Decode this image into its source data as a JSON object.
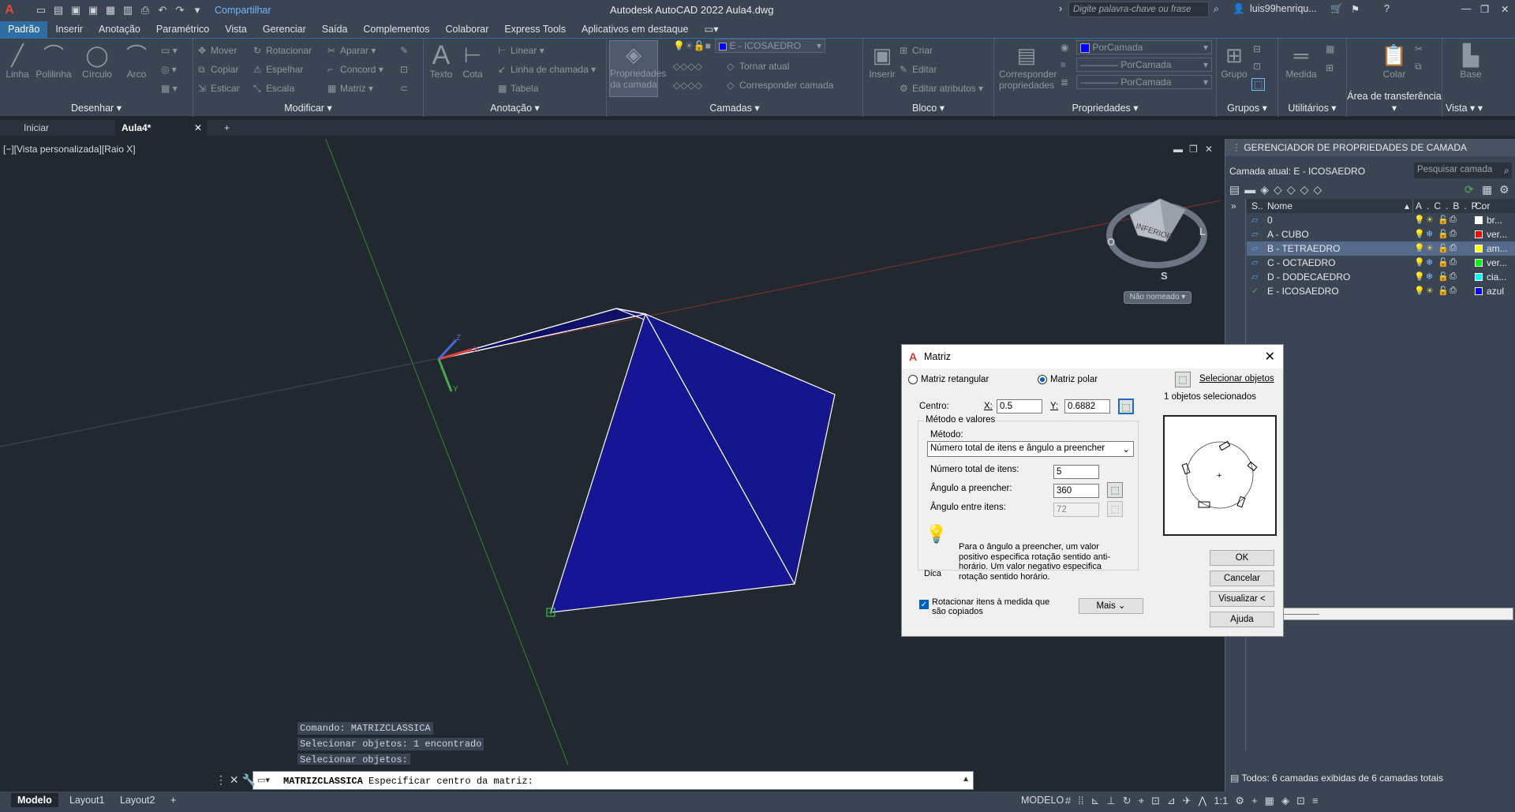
{
  "titlebar": {
    "app_title": "Autodesk AutoCAD 2022    Aula4.dwg",
    "share": "Compartilhar",
    "search_placeholder": "Digite palavra-chave ou frase",
    "user": "luis99henriqu..."
  },
  "ribbon_tabs": [
    "Padrão",
    "Inserir",
    "Anotação",
    "Paramétrico",
    "Vista",
    "Gerenciar",
    "Saída",
    "Complementos",
    "Colaborar",
    "Express Tools",
    "Aplicativos em destaque"
  ],
  "ribbon": {
    "desenhar": {
      "title": "Desenhar",
      "linha": "Linha",
      "polilinha": "Polilinha",
      "circulo": "Círculo",
      "arco": "Arco"
    },
    "modificar": {
      "title": "Modificar",
      "mover": "Mover",
      "rotacionar": "Rotacionar",
      "aparar": "Aparar",
      "copiar": "Copiar",
      "espelhar": "Espelhar",
      "concord": "Concord",
      "esticar": "Esticar",
      "escala": "Escala",
      "matriz": "Matriz"
    },
    "anotacao": {
      "title": "Anotação",
      "texto": "Texto",
      "cota": "Cota",
      "linear": "Linear",
      "linha_chamada": "Linha de chamada",
      "tabela": "Tabela"
    },
    "camadas": {
      "title": "Camadas",
      "prop_camada": "Propriedades da camada",
      "layer_dd": "E - ICOSAEDRO",
      "tornar_atual": "Tornar atual",
      "corresponder_camada": "Corresponder camada"
    },
    "bloco": {
      "title": "Bloco",
      "inserir": "Inserir",
      "criar": "Criar",
      "editar": "Editar",
      "editar_atributos": "Editar atributos"
    },
    "propriedades": {
      "title": "Propriedades",
      "corresponder": "Corresponder propriedades",
      "cor": "PorCamada",
      "tipolinha": "PorCamada",
      "espessura": "PorCamada"
    },
    "grupos": {
      "title": "Grupos",
      "grupo": "Grupo"
    },
    "utilitarios": {
      "title": "Utilitários",
      "medida": "Medida"
    },
    "transferencia": {
      "title": "Área de transferência",
      "colar": "Colar"
    },
    "vista": {
      "title": "Vista",
      "base": "Base"
    }
  },
  "file_tabs": {
    "iniciar": "Iniciar",
    "aula4": "Aula4*"
  },
  "viewport": {
    "label": "[−][Vista personalizada][Raio X]",
    "viewcube_face": "INFERIOR",
    "viewcube_s": "S",
    "viewcube_o": "O",
    "viewcube_l": "L",
    "ucs_name": "Não nomeado"
  },
  "command": {
    "history": [
      "Comando: MATRIZCLASSICA",
      "Selecionar objetos: 1 encontrado",
      "Selecionar objetos:"
    ],
    "current_cmd": "MATRIZCLASSICA",
    "current_prompt": "Especificar centro da matriz:"
  },
  "statusbar": {
    "modelo_tab": "Modelo",
    "layout1": "Layout1",
    "layout2": "Layout2",
    "model_label": "MODELO",
    "scale": "1:1"
  },
  "layer_palette": {
    "title": "GERENCIADOR DE PROPRIEDADES DE CAMADA",
    "current": "Camada atual: E - ICOSAEDRO",
    "search": "Pesquisar camada",
    "col_name": "Nome",
    "col_cor": "Cor",
    "layers": [
      {
        "name": "0",
        "color_name": "br...",
        "color": "#ffffff"
      },
      {
        "name": "A - CUBO",
        "color_name": "ver...",
        "color": "#ff0000"
      },
      {
        "name": "B - TETRAEDRO",
        "color_name": "am...",
        "color": "#ffff00"
      },
      {
        "name": "C - OCTAEDRO",
        "color_name": "ver...",
        "color": "#00ff00"
      },
      {
        "name": "D - DODECAEDRO",
        "color_name": "cia...",
        "color": "#00ffff"
      },
      {
        "name": "E - ICOSAEDRO",
        "color_name": "azul",
        "color": "#0000ff"
      }
    ],
    "footer": "Todos: 6 camadas exibidas de 6 camadas totais"
  },
  "dialog": {
    "title": "Matriz",
    "rect": "Matriz retangular",
    "polar": "Matriz polar",
    "select_objects": "Selecionar objetos",
    "objects_selected": "1 objetos selecionados",
    "centro": "Centro:",
    "x_label": "X:",
    "x_value": "0.5",
    "y_label": "Y:",
    "y_value": "0.6882",
    "metodo_valores": "Método e valores",
    "metodo": "Método:",
    "metodo_value": "Número total de itens e ângulo a preencher",
    "num_itens_label": "Número total de itens:",
    "num_itens": "5",
    "angulo_label": "Ângulo a preencher:",
    "angulo": "360",
    "angulo_entre_label": "Ângulo entre itens:",
    "angulo_entre": "72",
    "dica_label": "Dica",
    "dica_text": "Para o ângulo a preencher, um valor positivo especifica rotação sentido anti-horário. Um valor negativo especifica rotação sentido horário.",
    "rotate_label": "Rotacionar itens à medida que são copiados",
    "mais": "Mais",
    "ok": "OK",
    "cancelar": "Cancelar",
    "visualizar": "Visualizar <",
    "ajuda": "Ajuda"
  },
  "colors": {
    "accent": "#2f6ea4",
    "shape_fill": "#141479",
    "background": "#212830"
  }
}
